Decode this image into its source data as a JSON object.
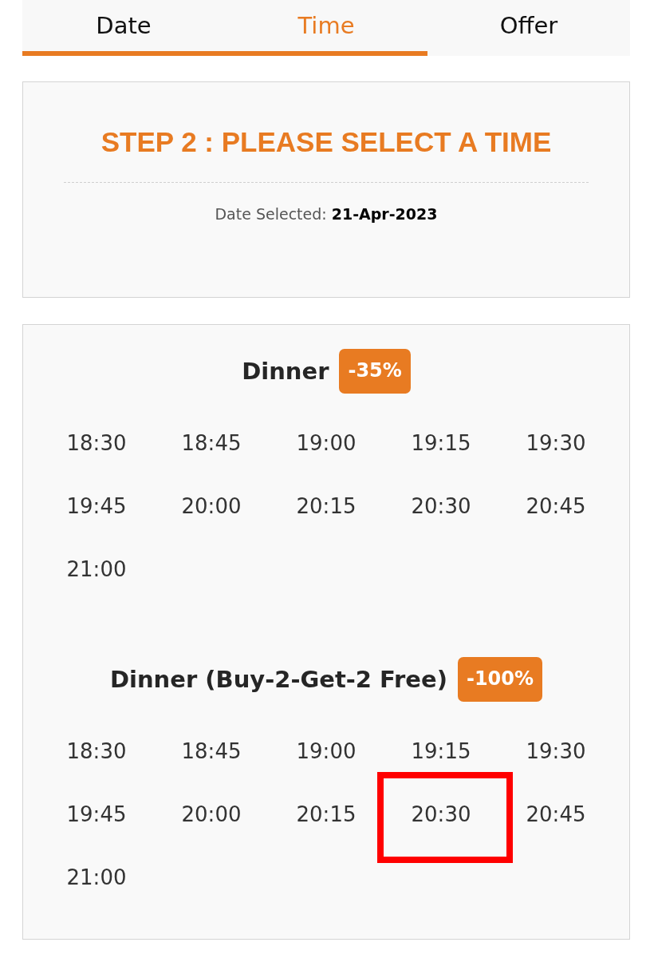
{
  "tabs": [
    {
      "label": "Date",
      "selected": false,
      "completed": true
    },
    {
      "label": "Time",
      "selected": true,
      "completed": false
    },
    {
      "label": "Offer",
      "selected": false,
      "completed": false
    }
  ],
  "step": {
    "title": "STEP 2 : PLEASE SELECT A TIME",
    "date_line": "Date Selected: **21-Apr-2023**"
  },
  "sessions": [
    {
      "name": "Dinner",
      "discount": "-35%",
      "slots": [
        {
          "time": "18:30",
          "marked": false
        },
        {
          "time": "18:45",
          "marked": false
        },
        {
          "time": "19:00",
          "marked": false
        },
        {
          "time": "19:15",
          "marked": false
        },
        {
          "time": "19:30",
          "marked": false
        },
        {
          "time": "19:45",
          "marked": false
        },
        {
          "time": "20:00",
          "marked": false
        },
        {
          "time": "20:15",
          "marked": false
        },
        {
          "time": "20:30",
          "marked": false
        },
        {
          "time": "20:45",
          "marked": false
        },
        {
          "time": "21:00",
          "marked": false
        }
      ]
    },
    {
      "name": "Dinner (Buy-2-Get-2 Free)",
      "discount": "-100%",
      "slots": [
        {
          "time": "18:30",
          "marked": false
        },
        {
          "time": "18:45",
          "marked": false
        },
        {
          "time": "19:00",
          "marked": false
        },
        {
          "time": "19:15",
          "marked": false
        },
        {
          "time": "19:30",
          "marked": false
        },
        {
          "time": "19:45",
          "marked": false
        },
        {
          "time": "20:00",
          "marked": false
        },
        {
          "time": "20:15",
          "marked": false
        },
        {
          "time": "20:30",
          "marked": true
        },
        {
          "time": "20:45",
          "marked": false
        },
        {
          "time": "21:00",
          "marked": false
        }
      ]
    }
  ]
}
